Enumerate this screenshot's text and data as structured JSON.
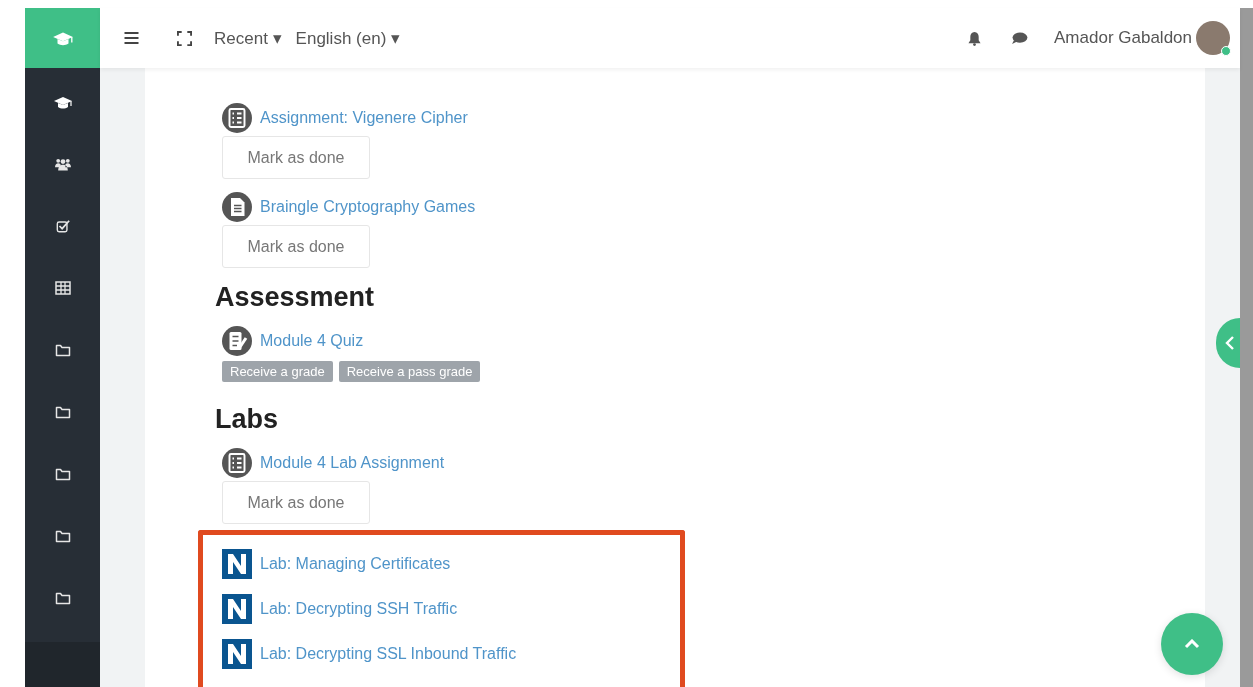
{
  "header": {
    "menus": [
      {
        "label": "Recent",
        "caret": "▾"
      },
      {
        "label": "English (en)",
        "caret": "▾"
      }
    ],
    "user_name": "Amador Gabaldon",
    "online": true
  },
  "sidebar": {
    "items": [
      {
        "kind": "course"
      },
      {
        "kind": "participants"
      },
      {
        "kind": "badges"
      },
      {
        "kind": "grades"
      },
      {
        "kind": "folder"
      },
      {
        "kind": "folder"
      },
      {
        "kind": "folder"
      },
      {
        "kind": "folder"
      },
      {
        "kind": "folder"
      }
    ]
  },
  "content": [
    {
      "kind": "assignment",
      "title": "Assignment: Vigenere Cipher"
    },
    {
      "kind": "completion",
      "label": "Mark as done"
    },
    {
      "kind": "page",
      "title": "Braingle Cryptography Games"
    },
    {
      "kind": "completion",
      "label": "Mark as done"
    },
    {
      "kind": "heading",
      "title": "Assessment"
    },
    {
      "kind": "quiz",
      "title": "Module 4 Quiz"
    },
    {
      "kind": "badges",
      "badges": [
        "Receive a grade",
        "Receive a pass grade"
      ]
    },
    {
      "kind": "heading",
      "title": "Labs"
    },
    {
      "kind": "assignment",
      "title": "Module 4 Lab Assignment"
    },
    {
      "kind": "completion",
      "label": "Mark as done"
    },
    {
      "kind": "highlight",
      "items": [
        {
          "kind": "lab",
          "title": "Lab: Managing Certificates"
        },
        {
          "kind": "lab",
          "title": "Lab: Decrypting SSH Traffic"
        },
        {
          "kind": "lab",
          "title": "Lab: Decrypting SSL Inbound Traffic"
        }
      ]
    }
  ]
}
